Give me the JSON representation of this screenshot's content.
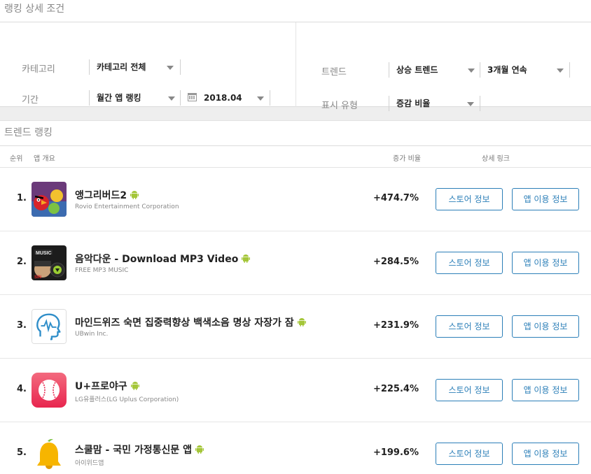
{
  "detail_section": {
    "title": "랭킹 상세 조건"
  },
  "filters": {
    "category_label": "카테고리",
    "category_value": "카테고리 전체",
    "period_label": "기간",
    "period_value": "월간 앱 랭킹",
    "date_value": "2018.04",
    "trend_label": "트렌드",
    "trend_value": "상승 트렌드",
    "trend_duration_value": "3개월 연속",
    "display_label": "표시 유형",
    "display_value": "증감 비율"
  },
  "trend_section": {
    "title": "트렌드 랭킹"
  },
  "table": {
    "headers": {
      "rank": "순위",
      "app": "앱 개요",
      "rate": "증가 비율",
      "links": "상세 링크"
    },
    "store_button": "스토어 정보",
    "usage_button": "앱 이용 정보",
    "rows": [
      {
        "rank": "1.",
        "name": "앵그리버드2",
        "publisher": "Rovio Entertainment Corporation",
        "rate": "+474.7%",
        "icon": "angry-birds-icon"
      },
      {
        "rank": "2.",
        "name": "음악다운 - Download MP3 Video",
        "publisher": "FREE MP3 MUSIC",
        "rate": "+284.5%",
        "icon": "music-download-icon"
      },
      {
        "rank": "3.",
        "name": "마인드위즈 숙면 집중력향상 백색소음 명상 자장가 잠",
        "publisher": "UBwin Inc.",
        "rate": "+231.9%",
        "icon": "mindwiz-head-icon"
      },
      {
        "rank": "4.",
        "name": "U+프로야구",
        "publisher": "LG유플러스(LG Uplus Corporation)",
        "rate": "+225.4%",
        "icon": "baseball-icon"
      },
      {
        "rank": "5.",
        "name": "스쿨맘 - 국민 가정통신문 앱",
        "publisher": "아이위드앱",
        "rate": "+199.6%",
        "icon": "school-bell-icon"
      }
    ]
  },
  "colors": {
    "accent": "#2c7fb8",
    "android": "#a4c639"
  }
}
